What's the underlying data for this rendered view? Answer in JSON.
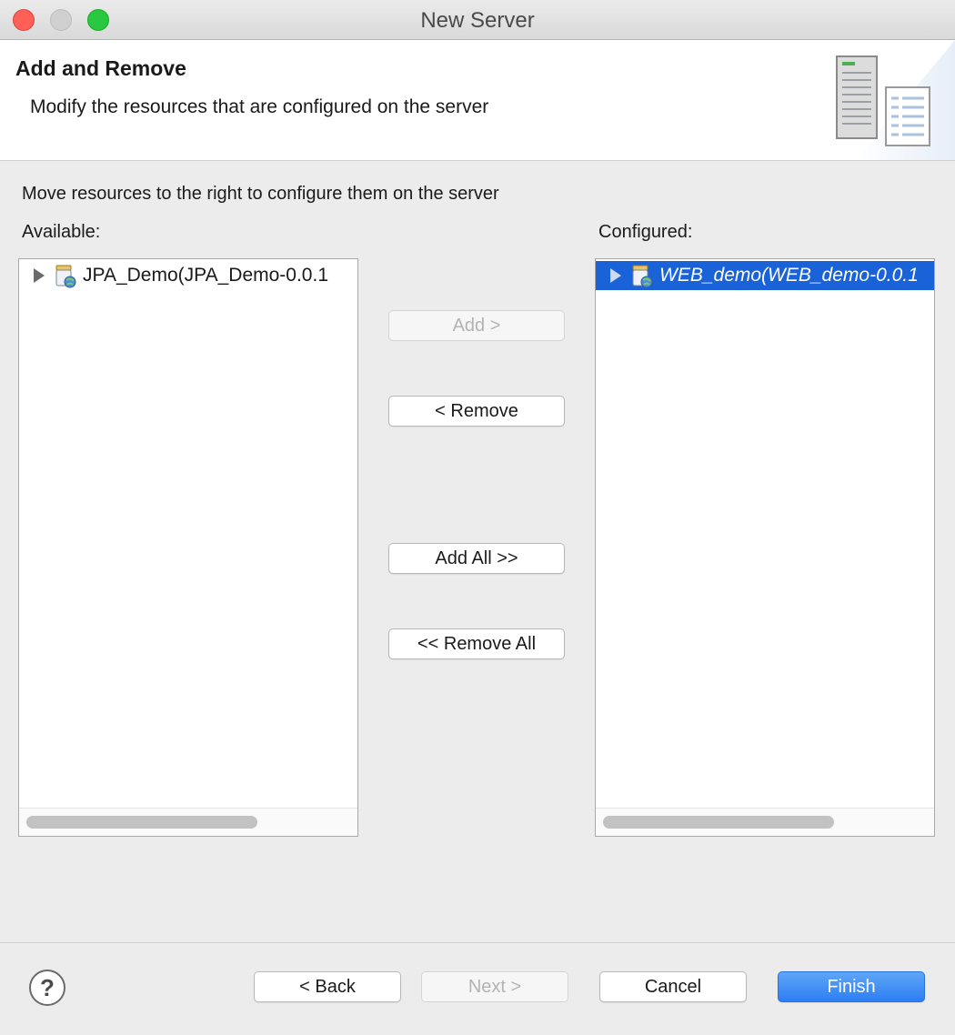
{
  "window": {
    "title": "New Server"
  },
  "header": {
    "title": "Add and Remove",
    "description": "Modify the resources that are configured on the server",
    "art_icon": "server-wizard-banner-icon"
  },
  "main": {
    "instruction": "Move resources to the right to configure them on the server",
    "available": {
      "label": "Available:",
      "items": [
        {
          "label": "JPA_Demo(JPA_Demo-0.0.1",
          "icon": "web-project-icon",
          "selected": false
        }
      ]
    },
    "configured": {
      "label": "Configured:",
      "items": [
        {
          "label": "WEB_demo(WEB_demo-0.0.1",
          "icon": "web-project-icon",
          "selected": true
        }
      ]
    },
    "buttons": {
      "add": "Add >",
      "remove": "< Remove",
      "add_all": "Add All >>",
      "remove_all": "<< Remove All"
    }
  },
  "footer": {
    "help": "?",
    "back": "< Back",
    "next": "Next >",
    "cancel": "Cancel",
    "finish": "Finish"
  },
  "colors": {
    "selection": "#1a62d8",
    "primary_button": "#2c7ef3",
    "close": "#fe5f57",
    "zoom": "#28c840"
  }
}
